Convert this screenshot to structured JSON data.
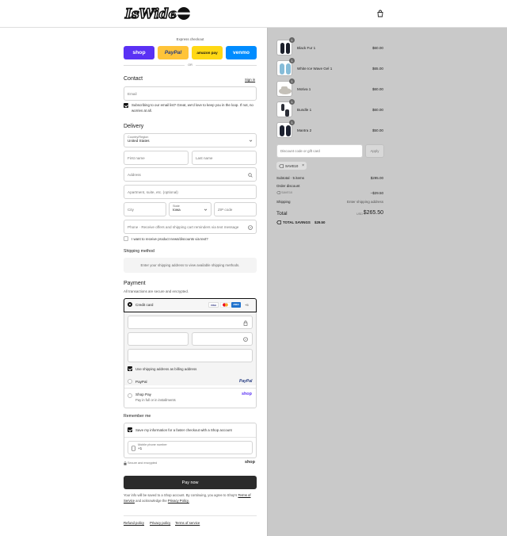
{
  "header": {
    "logo_text": "IsWide"
  },
  "express": {
    "title": "Express checkout",
    "buttons": [
      {
        "label": "shop",
        "bg": "#5a31f4",
        "fg": "#ffffff"
      },
      {
        "label": "PayPal",
        "bg": "#ffc439",
        "fg": "#253b80"
      },
      {
        "label": "amazon pay",
        "bg": "#ffd814",
        "fg": "#111111"
      },
      {
        "label": "venmo",
        "bg": "#008cff",
        "fg": "#ffffff"
      }
    ],
    "or": "OR"
  },
  "contact": {
    "title": "Contact",
    "sign_in": "Sign in",
    "email_placeholder": "Email",
    "subscribe_text": "Subscribing to our email list? Great, we'd love to keep you in the loop. If not, no worries at all."
  },
  "delivery": {
    "title": "Delivery",
    "country_label": "Country/Region",
    "country_value": "United States",
    "first_name": "First name",
    "last_name": "Last name",
    "address": "Address",
    "apartment": "Apartment, suite, etc. (optional)",
    "city": "City",
    "state_label": "State",
    "state_value": "Iowa",
    "zip": "ZIP code",
    "phone": "Phone · Receive offers and shipping cart reminders via text message",
    "news_text": "I want to receive product news/discounts via text?"
  },
  "shipping": {
    "title": "Shipping method",
    "note": "Enter your shipping address to view available shipping methods."
  },
  "payment": {
    "title": "Payment",
    "subtitle": "All transactions are secure and encrypted.",
    "credit_card": "Credit card",
    "card_badges": [
      "VISA",
      "MC",
      "AMEX",
      "+5"
    ],
    "billing_text": "Use shipping address as billing address",
    "paypal": "PayPal",
    "paypal_logo": "PayPal",
    "shop_pay": "Shop Pay",
    "shop_pay_sub": "Pay in full or in installments",
    "shop_logo": "shop"
  },
  "remember": {
    "title": "Remember me",
    "save_text": "Save my information for a faster checkout with a Shop account",
    "mobile_label": "Mobile phone number",
    "mobile_value": "+1",
    "secure": "Secure and encrypted",
    "shop_logo": "shop"
  },
  "pay_now": "Pay now",
  "terms": {
    "line1": "Your info will be saved to a Shop account. By continuing, you agree to Shop's",
    "tos": "Terms of Service",
    "mid": "and acknowledge the",
    "privacy": "Privacy Policy."
  },
  "footer": {
    "links": [
      "Refund policy",
      "Privacy policy",
      "Terms of service"
    ]
  },
  "cart": {
    "items": [
      {
        "name": "Black Fur 1",
        "price": "$60.00",
        "qty": "1",
        "color": "#1b1f2a"
      },
      {
        "name": "White Ice Wave Gel 1",
        "price": "$65.00",
        "qty": "1",
        "color": "#86bcd8"
      },
      {
        "name": "Motiva 1",
        "price": "$60.00",
        "qty": "1",
        "color": "#c4c0b8"
      },
      {
        "name": "Bundle 1",
        "price": "$60.00",
        "qty": "1",
        "color": "#2a2d36"
      },
      {
        "name": "Mantra 2",
        "price": "$50.00",
        "qty": "1",
        "color": "#1c2130"
      }
    ],
    "discount_placeholder": "Discount code or gift card",
    "apply": "Apply",
    "code": "SAVE10",
    "subtotal_label": "Subtotal · 5 items",
    "subtotal": "$295.00",
    "order_discount": "Order discount",
    "discount_code": "SAVE10",
    "discount_amount": "–$29.50",
    "shipping_label": "Shipping",
    "shipping_value": "Enter shipping address",
    "total_label": "Total",
    "currency": "USD",
    "total": "$265.50",
    "savings_label": "TOTAL SAVINGS",
    "savings": "$29.50"
  },
  "colors": {
    "accent": "#1a1a1a",
    "summary_bg": "#c9c9c9"
  }
}
